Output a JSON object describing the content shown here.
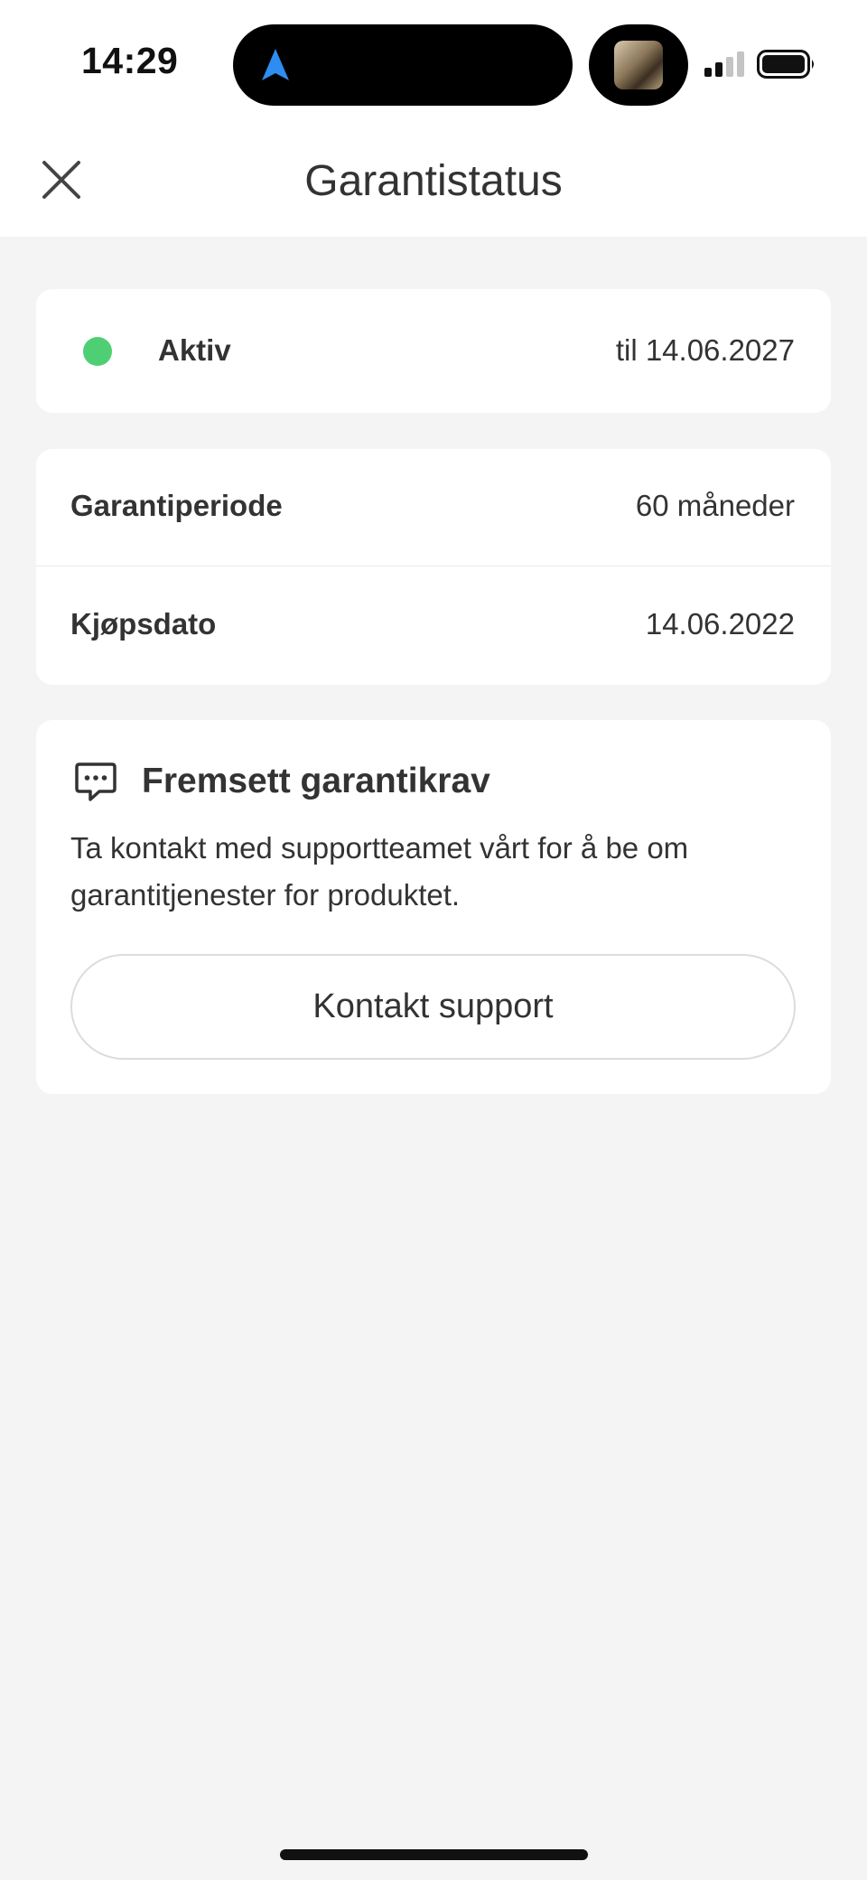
{
  "status_bar": {
    "time": "14:29",
    "icons": [
      "navigation-arrow-icon",
      "now-playing-thumbnail",
      "cellular-signal-icon",
      "battery-icon"
    ],
    "accent_color": "#2f8cf0"
  },
  "header": {
    "title": "Garantistatus",
    "close_icon": "close-icon"
  },
  "status": {
    "label": "Aktiv",
    "until": "til 14.06.2027",
    "indicator_color": "#4fcf74"
  },
  "details": {
    "rows": [
      {
        "label": "Garantiperiode",
        "value": "60 måneder"
      },
      {
        "label": "Kjøpsdato",
        "value": "14.06.2022"
      }
    ]
  },
  "claim": {
    "icon": "chat-bubble-icon",
    "title": "Fremsett garantikrav",
    "description": "Ta kontakt med supportteamet vårt for å be om garantitjenester for produktet.",
    "button_label": "Kontakt support"
  }
}
